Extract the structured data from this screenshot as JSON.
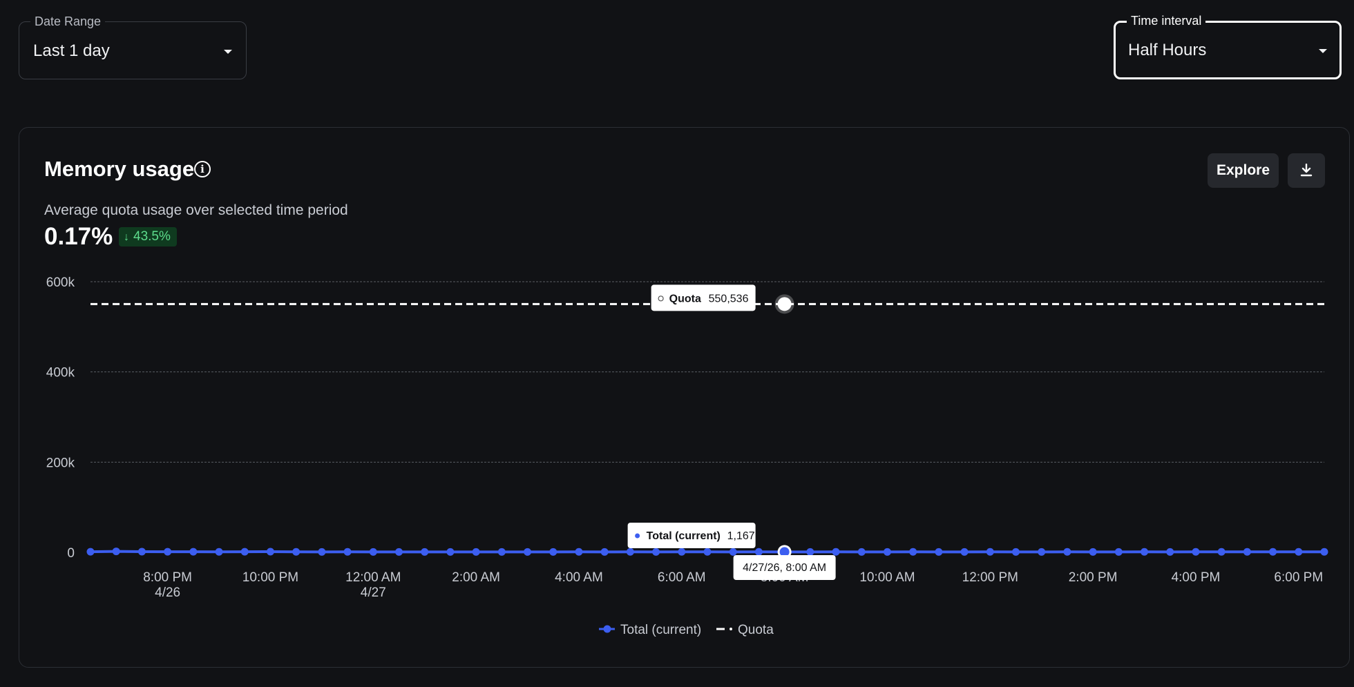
{
  "filters": {
    "date_range": {
      "label": "Date Range",
      "value": "Last 1 day"
    },
    "time_interval": {
      "label": "Time interval",
      "value": "Half Hours"
    }
  },
  "card": {
    "title": "Memory usage",
    "subtitle": "Average quota usage over selected time period",
    "value": "0.17%",
    "delta": "43.5%",
    "delta_direction": "down",
    "explore_label": "Explore",
    "download_icon": "download-icon"
  },
  "colors": {
    "total_series": "#3c5ef0",
    "quota_series": "#ffffff",
    "delta_positive": "#5ddc8c",
    "background": "#111215"
  },
  "chart_data": {
    "type": "line",
    "x_ticks": [
      {
        "time": "8:00 PM",
        "date": "4/26"
      },
      {
        "time": "10:00 PM",
        "date": ""
      },
      {
        "time": "12:00 AM",
        "date": "4/27"
      },
      {
        "time": "2:00 AM",
        "date": ""
      },
      {
        "time": "4:00 AM",
        "date": ""
      },
      {
        "time": "6:00 AM",
        "date": ""
      },
      {
        "time": "8:00 AM",
        "date": ""
      },
      {
        "time": "10:00 AM",
        "date": ""
      },
      {
        "time": "12:00 PM",
        "date": ""
      },
      {
        "time": "2:00 PM",
        "date": ""
      },
      {
        "time": "4:00 PM",
        "date": ""
      },
      {
        "time": "6:00 PM",
        "date": ""
      }
    ],
    "x_start": "4/26/26, 6:30 PM",
    "x_end": "4/27/26, 6:30 PM",
    "x_interval": "30 minutes",
    "y_ticks": [
      "0",
      "200k",
      "400k",
      "600k"
    ],
    "y_tick_values": [
      0,
      200000,
      400000,
      600000
    ],
    "ylim": [
      0,
      600000
    ],
    "grid": true,
    "legend_position": "bottom-center",
    "series": [
      {
        "name": "Total (current)",
        "values": [
          1400,
          2200,
          1500,
          1400,
          1300,
          1200,
          1300,
          1600,
          1100,
          1000,
          1100,
          1000,
          900,
          1000,
          900,
          900,
          1000,
          900,
          1000,
          1100,
          1000,
          1100,
          1000,
          1167,
          1100,
          1000,
          1100,
          1000,
          1000,
          1100,
          1000,
          1000,
          1100,
          1000,
          1000,
          1100,
          1000,
          1000,
          1100,
          1000,
          1000,
          1200,
          1000,
          1100,
          1200,
          1100,
          1200,
          1100,
          1200
        ]
      },
      {
        "name": "Quota",
        "style": "dashed",
        "constant_value": 550536
      }
    ],
    "hover": {
      "date_label": "4/27/26, 8:00 AM",
      "index": 27,
      "quota_tooltip": {
        "name": "Quota",
        "value": "550,536"
      },
      "total_tooltip": {
        "name": "Total (current)",
        "value": "1,167"
      }
    }
  }
}
